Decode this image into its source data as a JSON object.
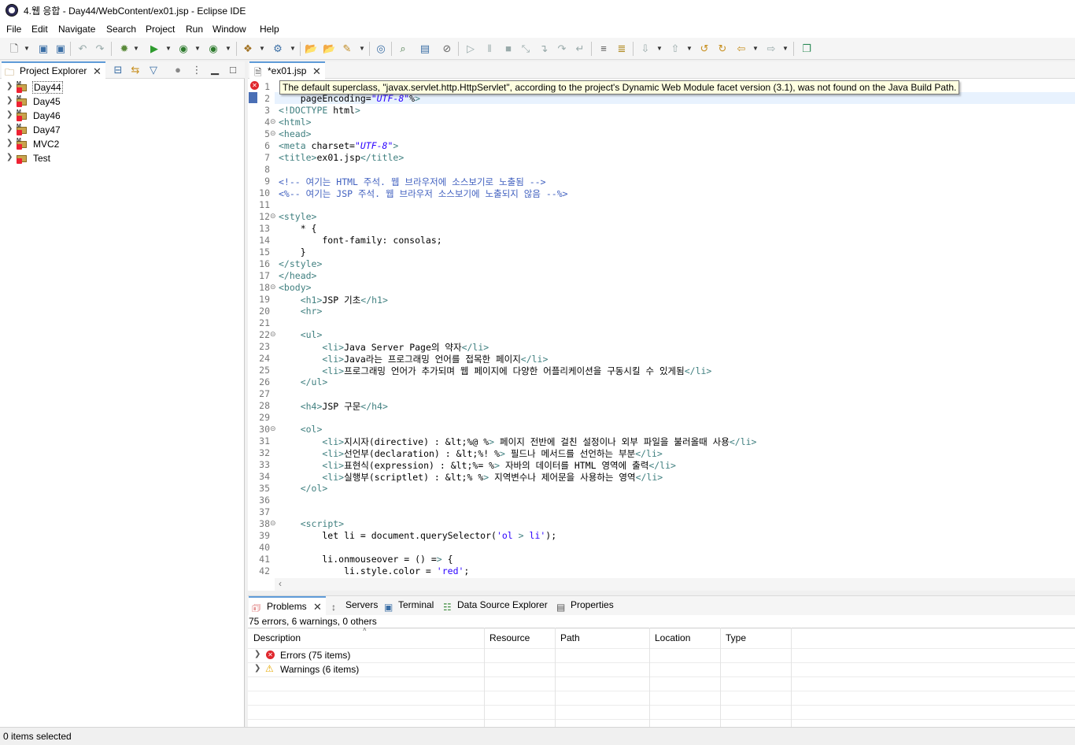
{
  "window": {
    "title": "4.웹 응합 - Day44/WebContent/ex01.jsp - Eclipse IDE"
  },
  "menu": [
    "File",
    "Edit",
    "Navigate",
    "Search",
    "Project",
    "Run",
    "Window",
    "Help"
  ],
  "project_explorer": {
    "title": "Project Explorer",
    "projects": [
      "Day44",
      "Day45",
      "Day46",
      "Day47",
      "MVC2",
      "Test"
    ],
    "selected": "Day44"
  },
  "editor": {
    "tab_label": "*ex01.jsp",
    "tooltip": "The default superclass, \"javax.servlet.http.HttpServlet\", according to the project's Dynamic Web Module facet version (3.1), was not found on the Java Build Path.",
    "lines": [
      {
        "n": "1",
        "t": ""
      },
      {
        "n": "2",
        "t": "    pageEncoding=\"UTF-8\"%>"
      },
      {
        "n": "3",
        "t": "<!DOCTYPE html>"
      },
      {
        "n": "4",
        "t": "<html>"
      },
      {
        "n": "5",
        "t": "<head>"
      },
      {
        "n": "6",
        "t": "<meta charset=\"UTF-8\">"
      },
      {
        "n": "7",
        "t": "<title>ex01.jsp</title>"
      },
      {
        "n": "8",
        "t": ""
      },
      {
        "n": "9",
        "t": "<!-- 여기는 HTML 주석. 웹 브라우저에 소스보기로 노출됨 -->"
      },
      {
        "n": "10",
        "t": "<%-- 여기는 JSP 주석. 웹 브라우저 소스보기에 노출되지 않음 --%>"
      },
      {
        "n": "11",
        "t": ""
      },
      {
        "n": "12",
        "t": "<style>"
      },
      {
        "n": "13",
        "t": "    * {"
      },
      {
        "n": "14",
        "t": "        font-family: consolas;"
      },
      {
        "n": "15",
        "t": "    }"
      },
      {
        "n": "16",
        "t": "</style>"
      },
      {
        "n": "17",
        "t": "</head>"
      },
      {
        "n": "18",
        "t": "<body>"
      },
      {
        "n": "19",
        "t": "    <h1>JSP 기초</h1>"
      },
      {
        "n": "20",
        "t": "    <hr>"
      },
      {
        "n": "21",
        "t": ""
      },
      {
        "n": "22",
        "t": "    <ul>"
      },
      {
        "n": "23",
        "t": "        <li>Java Server Page의 약자</li>"
      },
      {
        "n": "24",
        "t": "        <li>Java라는 프로그래밍 언어를 접목한 페이지</li>"
      },
      {
        "n": "25",
        "t": "        <li>프로그래밍 언어가 추가되며 웹 페이지에 다양한 어플리케이션을 구동시킬 수 있게됨</li>"
      },
      {
        "n": "26",
        "t": "    </ul>"
      },
      {
        "n": "27",
        "t": ""
      },
      {
        "n": "28",
        "t": "    <h4>JSP 구문</h4>"
      },
      {
        "n": "29",
        "t": ""
      },
      {
        "n": "30",
        "t": "    <ol>"
      },
      {
        "n": "31",
        "t": "        <li>지시자(directive) : &lt;%@ %> 페이지 전반에 걸친 설정이나 외부 파일을 불러올때 사용</li>"
      },
      {
        "n": "32",
        "t": "        <li>선언부(declaration) : &lt;%! %> 필드나 메서드를 선언하는 부분</li>"
      },
      {
        "n": "33",
        "t": "        <li>표현식(expression) : &lt;%= %> 자바의 데이터를 HTML 영역에 출력</li>"
      },
      {
        "n": "34",
        "t": "        <li>실행부(scriptlet) : &lt;% %> 지역변수나 제어문을 사용하는 영역</li>"
      },
      {
        "n": "35",
        "t": "    </ol>"
      },
      {
        "n": "36",
        "t": ""
      },
      {
        "n": "37",
        "t": ""
      },
      {
        "n": "38",
        "t": "    <script>"
      },
      {
        "n": "39",
        "t": "        let li = document.querySelector('ol > li');"
      },
      {
        "n": "40",
        "t": ""
      },
      {
        "n": "41",
        "t": "        li.onmouseover = () => {"
      },
      {
        "n": "42",
        "t": "            li.style.color = 'red';"
      }
    ]
  },
  "bottom": {
    "tabs": [
      "Problems",
      "Servers",
      "Terminal",
      "Data Source Explorer",
      "Properties"
    ],
    "summary": "75 errors, 6 warnings, 0 others",
    "columns": [
      "Description",
      "Resource",
      "Path",
      "Location",
      "Type"
    ],
    "rows": [
      "Errors (75 items)",
      "Warnings (6 items)"
    ]
  },
  "status": "0 items selected"
}
